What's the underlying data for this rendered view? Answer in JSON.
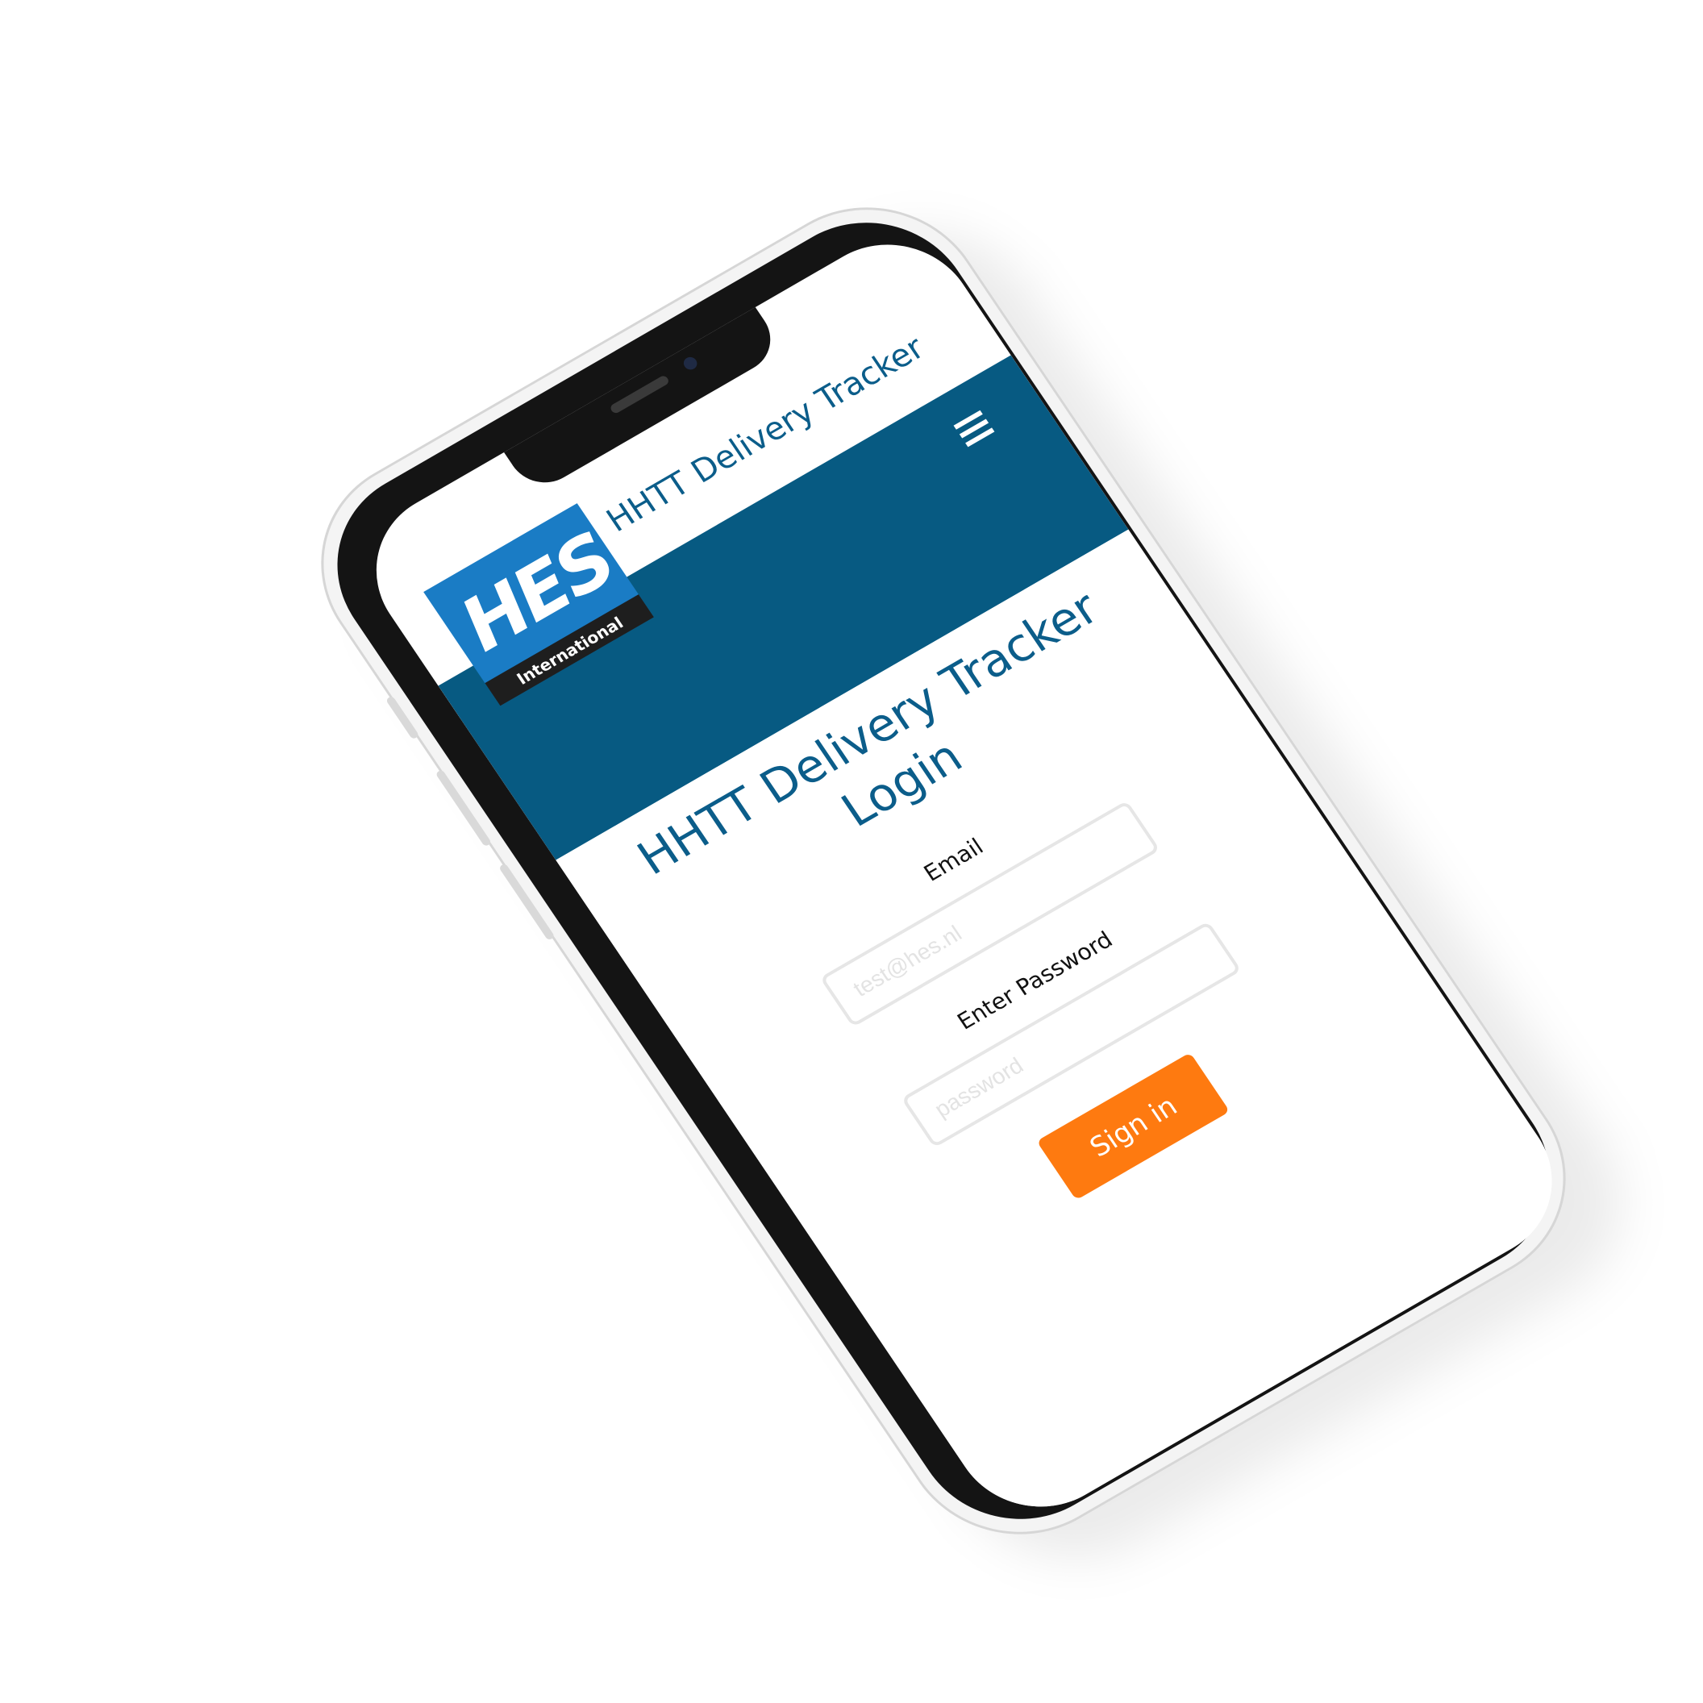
{
  "app": {
    "header_title": "HHTT Delivery Tracker"
  },
  "logo": {
    "mark": "HES",
    "subtitle": "International"
  },
  "nav": {
    "menu_icon": "hamburger-menu-icon"
  },
  "login": {
    "title": "HHTT Delivery Tracker",
    "subtitle": "Login",
    "email_label": "Email",
    "email_placeholder": "test@hes.nl",
    "password_label": "Enter Password",
    "password_placeholder": "password",
    "signin_label": "Sign in"
  },
  "colors": {
    "brand_blue": "#075a82",
    "logo_blue": "#1a7cc5",
    "heading_blue": "#0b5d8a",
    "button_orange": "#fe7a10"
  }
}
